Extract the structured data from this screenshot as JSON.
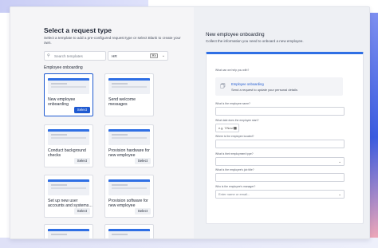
{
  "left": {
    "title": "Select a request type",
    "subtitle": "Select a template to add a pre-configured request type or select Blank to create your own.",
    "search_placeholder": "Search templates",
    "filter_value": "HR",
    "filter_shortcut": "⌘K",
    "category": "Employee onboarding",
    "templates": [
      {
        "name": "New employee onboarding",
        "button": "Select",
        "selected": true
      },
      {
        "name": "Send welcome messages",
        "button": "Select",
        "selected": false
      },
      {
        "name": "Conduct background checks",
        "button": "Select",
        "selected": false
      },
      {
        "name": "Provision hardware for new employee",
        "button": "Select",
        "selected": false
      },
      {
        "name": "Set up new user accounts and systems...",
        "button": "Select",
        "selected": false
      },
      {
        "name": "Provision software for new employee",
        "button": "Select",
        "selected": false
      }
    ]
  },
  "right": {
    "title": "New employee onboarding",
    "description": "Collect the information you need to onboard a new employee.",
    "form": {
      "q_help": "What can we help you with?",
      "help_option_title": "Employee onboarding",
      "help_option_desc": "Send a request to update your personal details",
      "q_name": "What is the employee name?",
      "q_start": "What date does the employee start?",
      "date_placeholder": "e.g. 7/Nov/23",
      "q_location": "Where is the employee located?",
      "q_type": "What is their employment type?",
      "q_title": "What is the employee's job title?",
      "q_manager": "Who is the employee's manager?",
      "manager_placeholder": "Enter name or email..."
    }
  },
  "colors": {
    "primary": "#1f5ad1",
    "accent_bar": "#2f6fe4"
  }
}
